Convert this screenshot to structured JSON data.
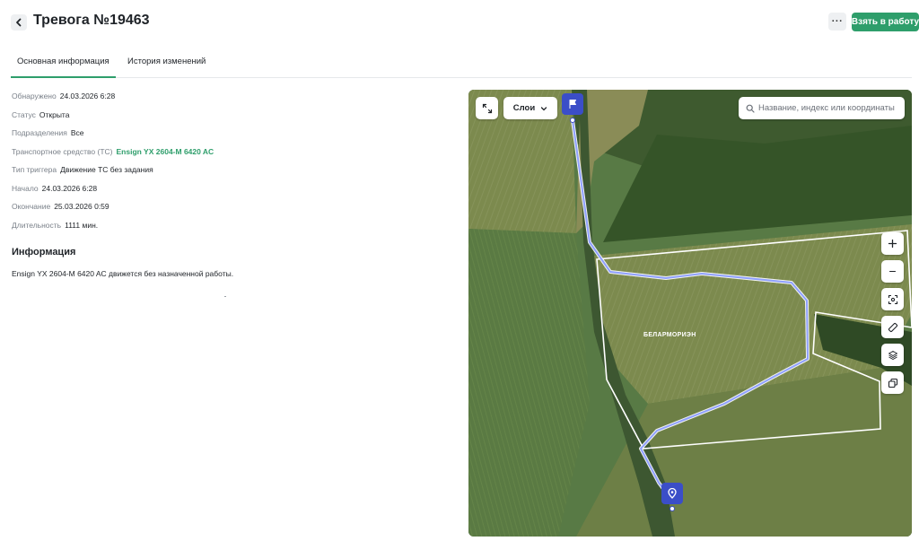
{
  "header": {
    "title": "Тревога №19463",
    "more_label": "···",
    "take_label": "Взять в работу"
  },
  "tabs": [
    {
      "label": "Основная информация",
      "active": true
    },
    {
      "label": "История изменений",
      "active": false
    }
  ],
  "details": [
    {
      "label": "Обнаружено",
      "value": "24.03.2026 6:28"
    },
    {
      "label": "Статус",
      "value": "Открыта"
    },
    {
      "label": "Подразделения",
      "value": "Все"
    },
    {
      "label": "Транспортное средство (ТС)",
      "value": "Ensign YX 2604-M 6420 AC",
      "link": true
    },
    {
      "label": "Тип триггера",
      "value": "Движение ТС без задания"
    },
    {
      "label": "Начало",
      "value": "24.03.2026 6:28"
    },
    {
      "label": "Окончание",
      "value": "25.03.2026 0:59"
    },
    {
      "label": "Длительность",
      "value": "1111 мин."
    }
  ],
  "info": {
    "title": "Информация",
    "text": "Ensign YX 2604-M  6420 AC   движется без назначенной работы."
  },
  "map": {
    "layers_label": "Слои",
    "search_placeholder": "Название, индекс или координаты",
    "field_label": "БЕЛАРМОРИЭН",
    "controls": [
      "zoom-in",
      "zoom-out",
      "focus",
      "ruler",
      "layers",
      "copy"
    ],
    "track_color": "#8fa0ff",
    "marker_color": "#3b4ec8"
  },
  "colors": {
    "accent": "#2e9e6b",
    "text": "#1f2328",
    "muted": "#7a8089"
  }
}
